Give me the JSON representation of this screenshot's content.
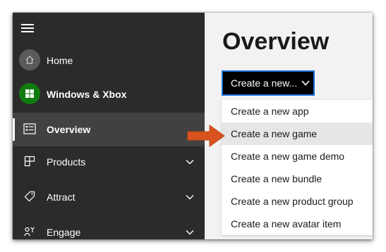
{
  "sidebar": {
    "items": [
      {
        "label": "Home",
        "icon": "home-icon"
      },
      {
        "label": "Windows & Xbox",
        "icon": "windows-logo-icon"
      },
      {
        "label": "Overview",
        "icon": "dashboard-icon",
        "active": true
      },
      {
        "label": "Products",
        "icon": "products-icon",
        "expandable": true
      },
      {
        "label": "Attract",
        "icon": "tag-icon",
        "expandable": true
      },
      {
        "label": "Engage",
        "icon": "engage-icon",
        "expandable": true
      }
    ]
  },
  "main": {
    "title": "Overview",
    "create_button_label": "Create a new...",
    "dropdown_items": [
      "Create a new app",
      "Create a new game",
      "Create a new game demo",
      "Create a new bundle",
      "Create a new product group",
      "Create a new avatar item"
    ],
    "highlighted_item": "Create a new game"
  },
  "colors": {
    "sidebar_bg": "#2b2b2b",
    "accent_border": "#1e6fd9",
    "callout_arrow": "#d9531e",
    "windows_green": "#107c10"
  }
}
